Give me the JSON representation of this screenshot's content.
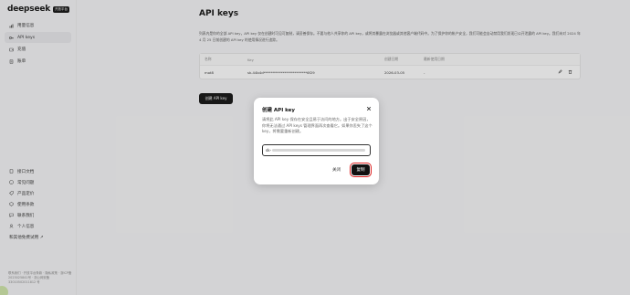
{
  "brand": {
    "name": "deepseek",
    "badge": "开放平台"
  },
  "sidebar": {
    "items": [
      {
        "label": "用量信息",
        "icon": "chart-icon",
        "active": false
      },
      {
        "label": "API keys",
        "icon": "key-icon",
        "active": true
      },
      {
        "label": "充值",
        "icon": "wallet-icon",
        "active": false
      },
      {
        "label": "账单",
        "icon": "bill-icon",
        "active": false
      }
    ],
    "bottom_items": [
      {
        "label": "接口文档",
        "icon": "doc-icon"
      },
      {
        "label": "常见问题",
        "icon": "question-icon"
      },
      {
        "label": "产品定价",
        "icon": "price-icon"
      },
      {
        "label": "使用条款",
        "icon": "terms-icon"
      },
      {
        "label": "联系我们",
        "icon": "contact-icon"
      },
      {
        "label": "个人信息",
        "icon": "user-icon"
      },
      {
        "label": "和其他免费试用 ↗",
        "icon": ""
      }
    ],
    "footer": "联系我们 · 开放平台条款 · 隐私政策 · 浙ICP备2023025841号 · 浙公网安备 33010502011812 号"
  },
  "main": {
    "title": "API keys",
    "description": "列表内是你的全部 API key，API key 仅在创建时可见可复制，请妥善保存。不要与他人共享你的 API key，或将其暴露在浏览器或其他客户端代码中。为了保护你的帐户安全，我们可能会自动禁用我们发现已公开泄露的 API key。我们未对 2024 年 4 月 25 日前创建的 API key 的使用情况进行追踪。",
    "table": {
      "headers": [
        "名称",
        "Key",
        "创建日期",
        "最新使用日期",
        ""
      ],
      "rows": [
        {
          "name": "mot8",
          "key": "sk-44b4d*************************6f29",
          "created": "2026-03-05",
          "last_used": "-"
        }
      ]
    },
    "create_button": "创建 API key"
  },
  "modal": {
    "title": "创建 API key",
    "description": "请将此 API key 保存在安全且易于访问的地方。出于安全原因，你将无法通过 API keys 管理界面再次查看它。如果你丢失了这个 key，将需要重新创建。",
    "key_prefix": "sk-",
    "cancel": "关闭",
    "copy": "复制"
  },
  "colors": {
    "accent": "#111111",
    "highlight": "#dd2222",
    "overlay": "rgba(60,60,60,0.18)"
  }
}
